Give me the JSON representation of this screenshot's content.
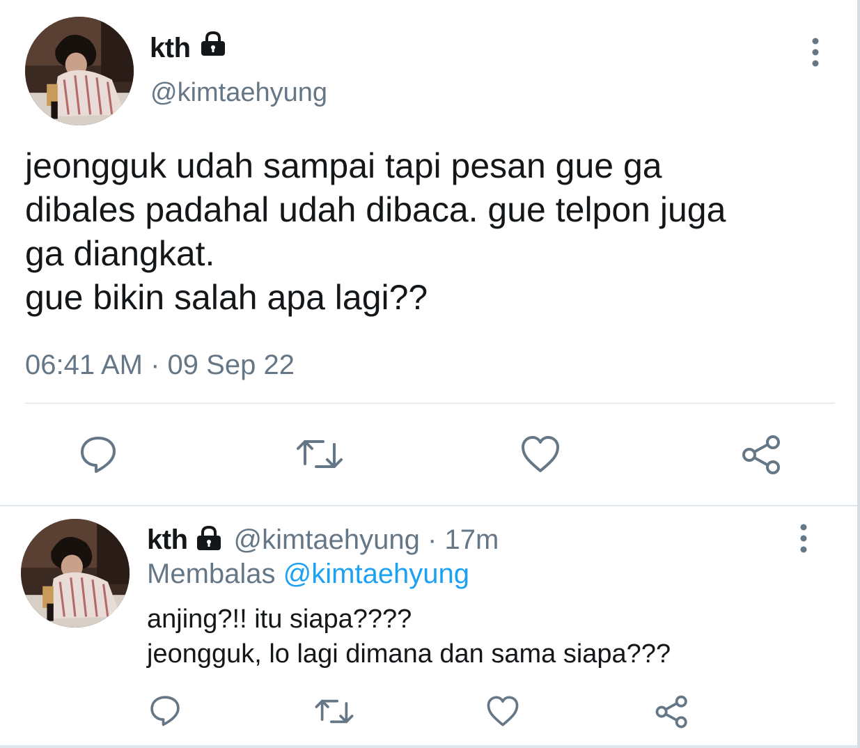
{
  "main_tweet": {
    "display_name": "kth",
    "handle": "@kimtaehyung",
    "text_lines": [
      "jeongguk udah sampai tapi pesan gue ga",
      "dibales padahal udah dibaca. gue telpon juga",
      "ga diangkat.",
      "gue bikin salah apa lagi??"
    ],
    "timestamp": "06:41 AM · 09 Sep 22",
    "icons": [
      "lock-icon",
      "more-vertical-icon",
      "reply-icon",
      "retweet-icon",
      "like-icon",
      "share-icon"
    ]
  },
  "reply_tweet": {
    "display_name": "kth",
    "handle_time": "@kimtaehyung · 17m",
    "replying_prefix": "Membalas",
    "replying_to": "@kimtaehyung",
    "text_lines": [
      "anjing?!! itu siapa????",
      "jeongguk, lo lagi dimana dan sama siapa???"
    ],
    "icons": [
      "lock-icon",
      "more-vertical-icon",
      "reply-icon",
      "retweet-icon",
      "like-icon",
      "share-icon"
    ]
  },
  "colors": {
    "text_primary": "#14171a",
    "text_secondary": "#657786",
    "link": "#1da1f2",
    "divider": "#e6ecf0"
  }
}
